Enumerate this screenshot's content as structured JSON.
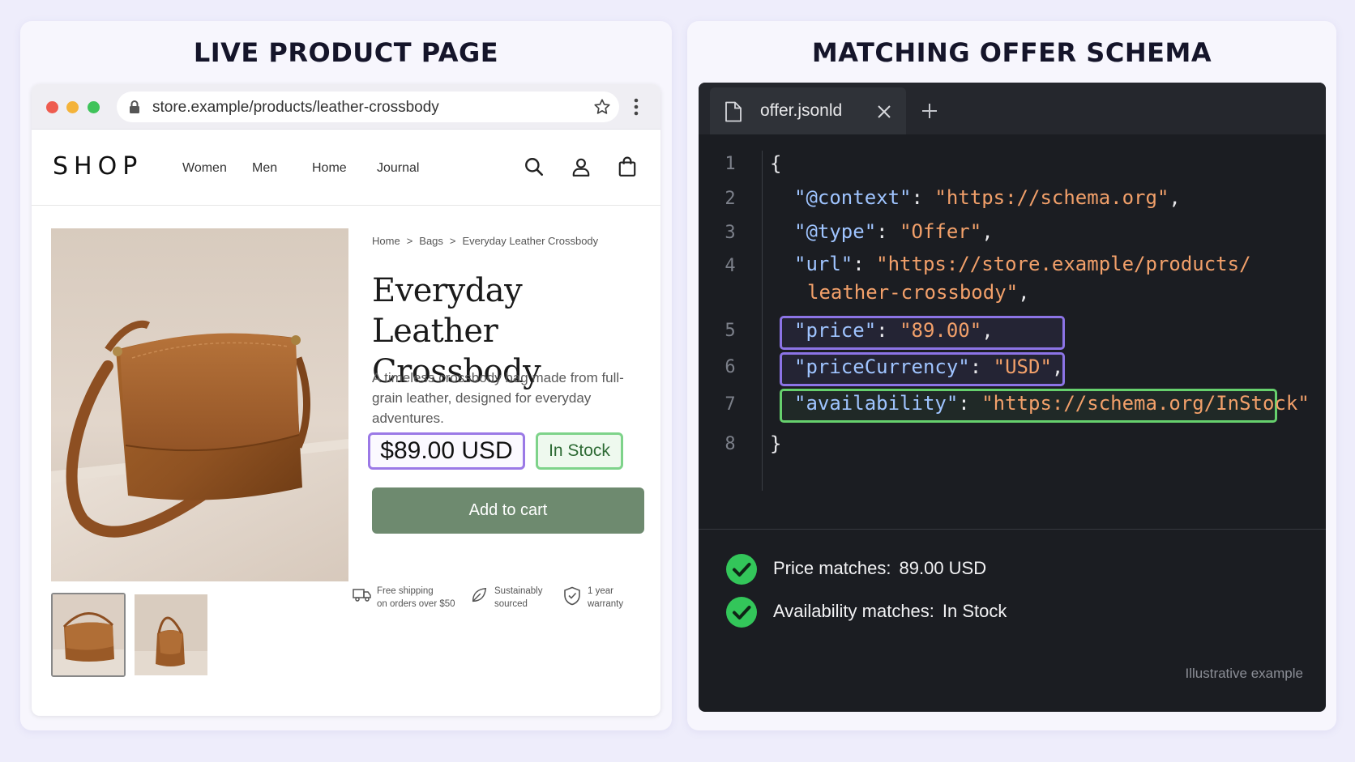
{
  "left_panel": {
    "title": "LIVE PRODUCT PAGE",
    "browser": {
      "url": "store.example/products/leather-crossbody",
      "icons": [
        "lock-icon",
        "star-icon",
        "more-vertical-icon"
      ],
      "site": {
        "logo": "SHOP",
        "nav": [
          "Women",
          "Men",
          "Home",
          "Journal"
        ],
        "nav_icons": [
          "search-icon",
          "user-icon",
          "bag-icon"
        ]
      },
      "product": {
        "breadcrumb": [
          "Home",
          "Bags",
          "Everyday Leather Crossbody"
        ],
        "breadcrumb_sep": ">",
        "title_line1": "Everyday Leather",
        "title_line2": "Crossbody",
        "description": "A timeless crossbody bag made from full-grain leather, designed for everyday adventures.",
        "price": "$89.00 USD",
        "stock": "In Stock",
        "add_to_cart": "Add to cart",
        "features": [
          {
            "icon": "truck-icon",
            "line1": "Free shipping",
            "line2": "on orders over $50"
          },
          {
            "icon": "leaf-icon",
            "line1": "Sustainably",
            "line2": "sourced"
          },
          {
            "icon": "shield-check-icon",
            "line1": "1 year",
            "line2": "warranty"
          }
        ]
      }
    }
  },
  "right_panel": {
    "title": "MATCHING OFFER SCHEMA",
    "editor": {
      "tab_name": "offer.jsonld",
      "code": {
        "ln": [
          "1",
          "2",
          "3",
          "4",
          "5",
          "6",
          "7",
          "8"
        ],
        "open_brace": "{",
        "close_brace": "}",
        "context_key": "\"@context\"",
        "context_val": "\"https://schema.org\"",
        "type_key": "\"@type\"",
        "type_val": "\"Offer\"",
        "url_key": "\"url\"",
        "url_val_1": "\"https://store.example/products/",
        "url_val_2": "leather-crossbody\"",
        "price_key": "\"price\"",
        "price_val": "\"89.00\"",
        "currency_key": "\"priceCurrency\"",
        "currency_val": "\"USD\"",
        "availability_key": "\"availability\"",
        "availability_val": "\"https://schema.org/InStock\"",
        "colon": ": ",
        "comma": ","
      },
      "checks": [
        {
          "label": "Price matches:",
          "value": "89.00 USD"
        },
        {
          "label": "Availability matches:",
          "value": "In Stock"
        }
      ],
      "footnote": "Illustrative example"
    }
  },
  "colors": {
    "price_highlight": "#9b79e6",
    "stock_highlight": "#7ed38a",
    "add_to_cart": "#6e8a6f",
    "code_key": "#9fc4ff",
    "code_string": "#f2a06a",
    "check_green": "#33c65a"
  }
}
